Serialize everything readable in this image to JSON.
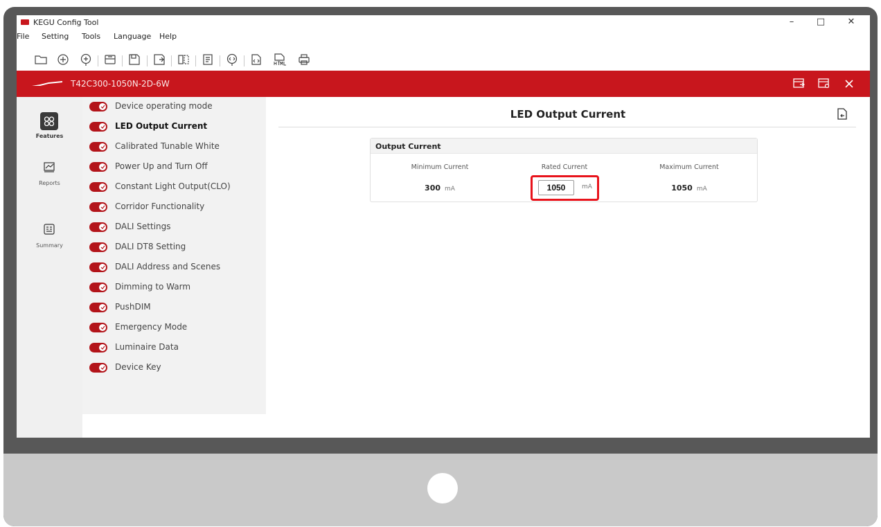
{
  "window": {
    "title": "KEGU Config Tool",
    "minimize_glyph": "–",
    "maximize_glyph": "□",
    "close_glyph": "✕"
  },
  "menu": [
    "File",
    "Setting",
    "Tools",
    "Language",
    "Help"
  ],
  "toolbar_icons": [
    "open-folder-icon",
    "add-circle-icon",
    "add-upload-icon",
    "device-read-icon",
    "save-icon",
    "save-as-icon",
    "compare-icon",
    "document-icon",
    "read-device-icon",
    "code-export-icon",
    "html-export-icon",
    "print-icon"
  ],
  "header": {
    "device_name": "T42C300-1050N-2D-6W",
    "accent_color": "#c8161d"
  },
  "rail": {
    "features_label": "Features",
    "reports_label": "Reports",
    "summary_label": "Summary"
  },
  "features": [
    "Device operating mode",
    "LED Output Current",
    "Calibrated Tunable White",
    "Power Up and Turn Off",
    "Constant Light Output(CLO)",
    "Corridor Functionality",
    "DALI Settings",
    "DALI DT8 Setting",
    "DALI Address and Scenes",
    "Dimming to Warm",
    "PushDIM",
    "Emergency Mode",
    "Luminaire Data",
    "Device Key"
  ],
  "active_feature": "LED Output Current",
  "main": {
    "title": "LED Output Current",
    "card_title": "Output Current",
    "min_label": "Minimum Current",
    "rated_label": "Rated Current",
    "max_label": "Maximum Current",
    "min_value": "300",
    "rated_value": "1050",
    "max_value": "1050",
    "unit": "mA"
  }
}
